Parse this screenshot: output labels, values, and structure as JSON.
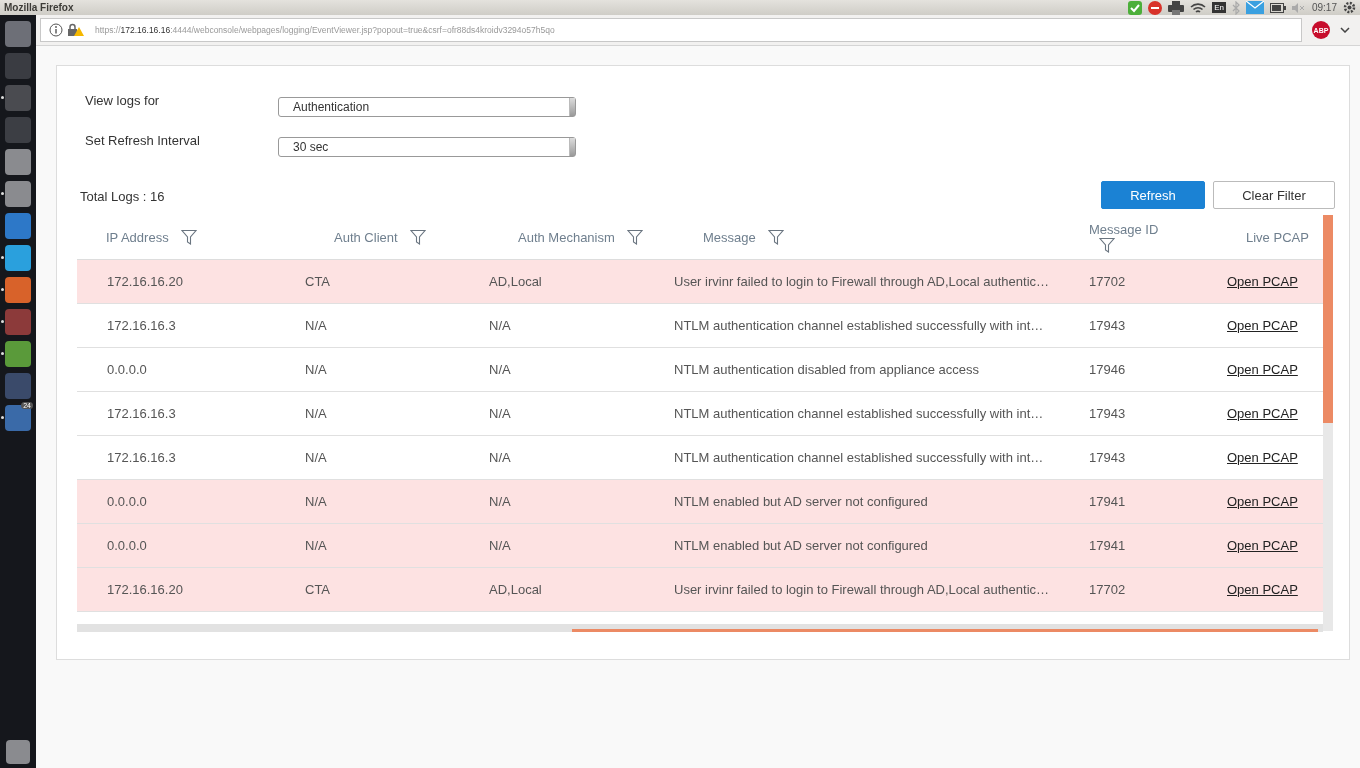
{
  "window": {
    "title": "Mozilla Firefox"
  },
  "tray": {
    "keyboard": "En",
    "clock": "09:17"
  },
  "adblock": "ABP",
  "launcher": [
    {
      "kind": "ubuntu",
      "running": false
    },
    {
      "kind": "tools",
      "running": false
    },
    {
      "kind": "terminal",
      "running": true
    },
    {
      "kind": "monitor",
      "running": false
    },
    {
      "kind": "disk",
      "running": false
    },
    {
      "kind": "disk",
      "running": true
    },
    {
      "kind": "wave",
      "running": false
    },
    {
      "kind": "skype",
      "running": true
    },
    {
      "kind": "firefox",
      "running": true
    },
    {
      "kind": "archive",
      "running": true
    },
    {
      "kind": "vmware",
      "running": true
    },
    {
      "kind": "network",
      "running": false
    },
    {
      "kind": "mail",
      "running": true,
      "badge": "24"
    }
  ],
  "address_bar": {
    "scheme": "https://",
    "host": "172.16.16.16",
    "rest": ":4444/webconsole/webpages/logging/EventViewer.jsp?popout=true&csrf=ofr88ds4kroidv3294o57h5qo"
  },
  "filters": [
    {
      "label": "View logs for",
      "value": "Authentication"
    },
    {
      "label": "Set Refresh Interval",
      "value": "30 sec"
    }
  ],
  "total_logs": "Total Logs : 16",
  "buttons": [
    {
      "label": "Refresh",
      "kind": "primary"
    },
    {
      "label": "Clear Filter",
      "kind": "secondary"
    }
  ],
  "table": {
    "columns": [
      {
        "label": "IP Address",
        "filter": true
      },
      {
        "label": "Auth Client",
        "filter": true
      },
      {
        "label": "Auth Mechanism",
        "filter": true
      },
      {
        "label": "Message",
        "filter": true
      },
      {
        "label": "Message ID",
        "filter": true
      },
      {
        "label": "Live PCAP",
        "filter": false
      }
    ],
    "rows": [
      {
        "highlighted": true,
        "cells": [
          "172.16.16.20",
          "CTA",
          "AD,Local",
          "User irvinr failed to login to Firewall through AD,Local authentic…",
          "17702"
        ],
        "link": "Open PCAP"
      },
      {
        "highlighted": false,
        "cells": [
          "172.16.16.3",
          "N/A",
          "N/A",
          "NTLM authentication channel established successfully with int…",
          "17943"
        ],
        "link": "Open PCAP"
      },
      {
        "highlighted": false,
        "cells": [
          "0.0.0.0",
          "N/A",
          "N/A",
          "NTLM authentication disabled from appliance access",
          "17946"
        ],
        "link": "Open PCAP"
      },
      {
        "highlighted": false,
        "cells": [
          "172.16.16.3",
          "N/A",
          "N/A",
          "NTLM authentication channel established successfully with int…",
          "17943"
        ],
        "link": "Open PCAP"
      },
      {
        "highlighted": false,
        "cells": [
          "172.16.16.3",
          "N/A",
          "N/A",
          "NTLM authentication channel established successfully with int…",
          "17943"
        ],
        "link": "Open PCAP"
      },
      {
        "highlighted": true,
        "cells": [
          "0.0.0.0",
          "N/A",
          "N/A",
          "NTLM enabled but AD server not configured",
          "17941"
        ],
        "link": "Open PCAP"
      },
      {
        "highlighted": true,
        "cells": [
          "0.0.0.0",
          "N/A",
          "N/A",
          "NTLM enabled but AD server not configured",
          "17941"
        ],
        "link": "Open PCAP"
      },
      {
        "highlighted": true,
        "cells": [
          "172.16.16.20",
          "CTA",
          "AD,Local",
          "User irvinr failed to login to Firewall through AD,Local authentic…",
          "17702"
        ],
        "link": "Open PCAP"
      }
    ]
  }
}
